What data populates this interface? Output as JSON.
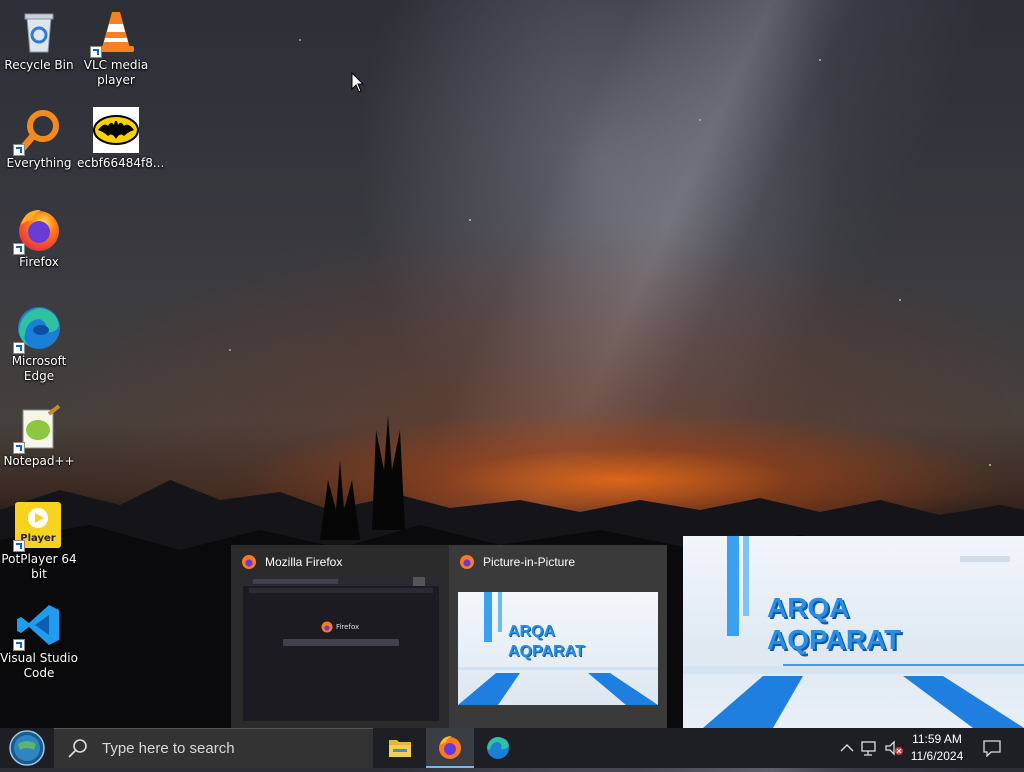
{
  "desktop_icons": [
    {
      "label": "Recycle Bin",
      "icon": "recycle-bin-icon"
    },
    {
      "label": "VLC media player",
      "icon": "vlc-cone-icon"
    },
    {
      "label": "Everything",
      "icon": "everything-magnifier-icon"
    },
    {
      "label": "ecbf66484f8...",
      "icon": "batman-logo-icon"
    },
    {
      "label": "Firefox",
      "icon": "firefox-icon"
    },
    {
      "label": "Microsoft Edge",
      "icon": "edge-icon"
    },
    {
      "label": "Notepad++",
      "icon": "notepadpp-icon"
    },
    {
      "label": "PotPlayer 64 bit",
      "icon": "potplayer-icon"
    },
    {
      "label": "Visual Studio Code",
      "icon": "vscode-icon"
    }
  ],
  "potplayer_icon_text": "Player",
  "taskbar_previews": [
    {
      "title": "Mozilla Firefox",
      "thumb_text": "Firefox"
    },
    {
      "title": "Picture-in-Picture",
      "thumb_text": [
        "ARQA",
        "AQPARAT"
      ]
    }
  ],
  "pip_window": {
    "text": [
      "ARQA",
      "AQPARAT"
    ]
  },
  "taskbar": {
    "search_placeholder": "Type here to search",
    "apps": [
      "file-explorer-icon",
      "firefox-icon",
      "edge-icon"
    ],
    "tray_icons": [
      "chevron-up-icon",
      "network-icon",
      "volume-muted-icon",
      "notification-icon"
    ],
    "time": "11:59 AM",
    "date": "11/6/2024"
  },
  "colors": {
    "taskbar": "#1d1f24",
    "accent": "#76b9ed",
    "preview_bg": "#2b2b2b"
  }
}
